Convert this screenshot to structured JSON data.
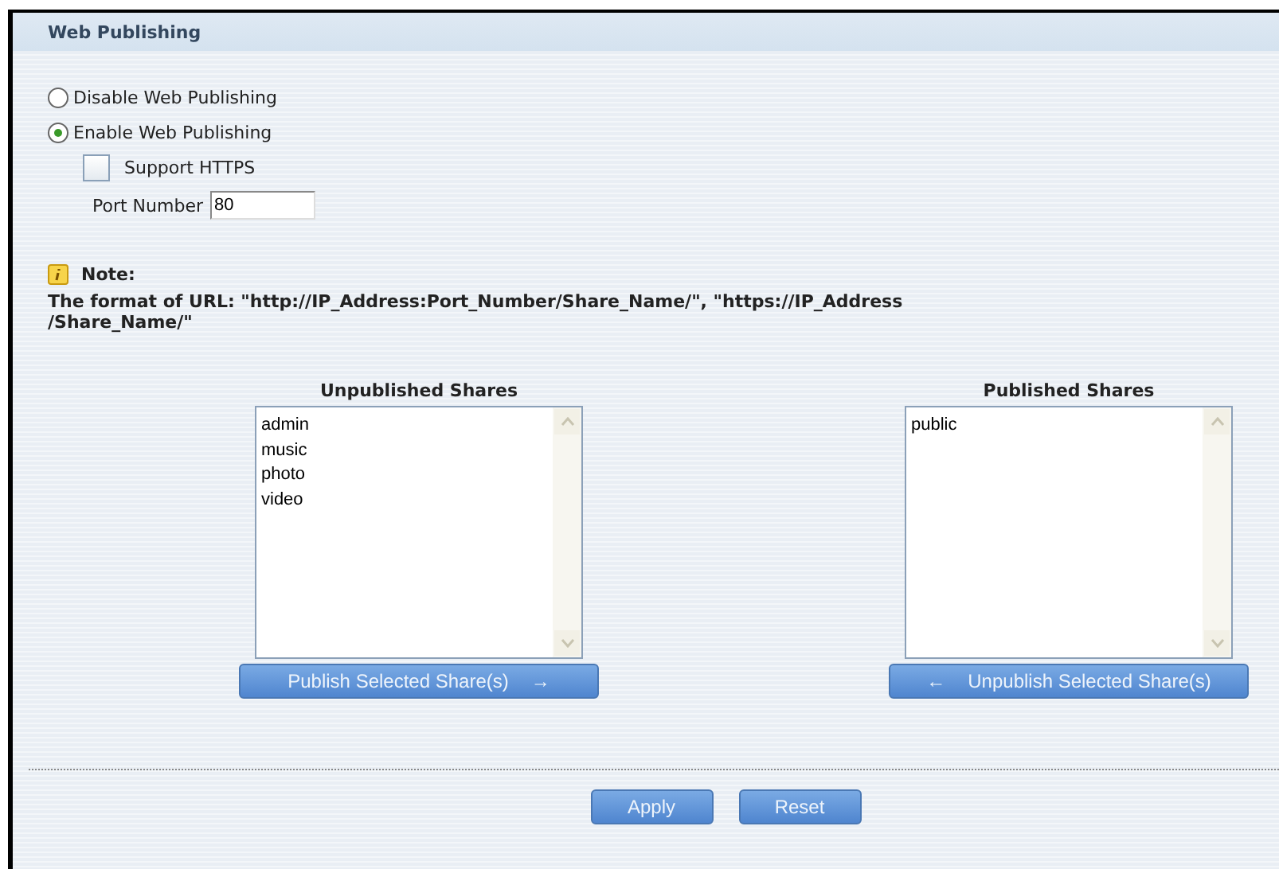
{
  "panel": {
    "title": "Web Publishing"
  },
  "mode_options": [
    {
      "label": "Disable Web Publishing",
      "selected": false
    },
    {
      "label": "Enable Web Publishing",
      "selected": true
    }
  ],
  "support_https": {
    "label": "Support HTTPS",
    "checked": false
  },
  "port_number": {
    "label": "Port Number",
    "value": "80"
  },
  "note": {
    "title": "Note:",
    "text": "The format of URL: \"http://IP_Address:Port_Number/Share_Name/\", \"https://IP_Address /Share_Name/\""
  },
  "share_lists": [
    {
      "title": "Unpublished Shares",
      "items": [
        "admin",
        "music",
        "photo",
        "video"
      ],
      "button": {
        "label": "Publish Selected Share(s)",
        "arrow": "→",
        "kind": "publish"
      }
    },
    {
      "title": "Published Shares",
      "items": [
        "public"
      ],
      "button": {
        "label": "Unpublish Selected Share(s)",
        "arrow": "←",
        "kind": "unpublish"
      }
    }
  ],
  "buttons": [
    "Apply",
    "Reset"
  ]
}
